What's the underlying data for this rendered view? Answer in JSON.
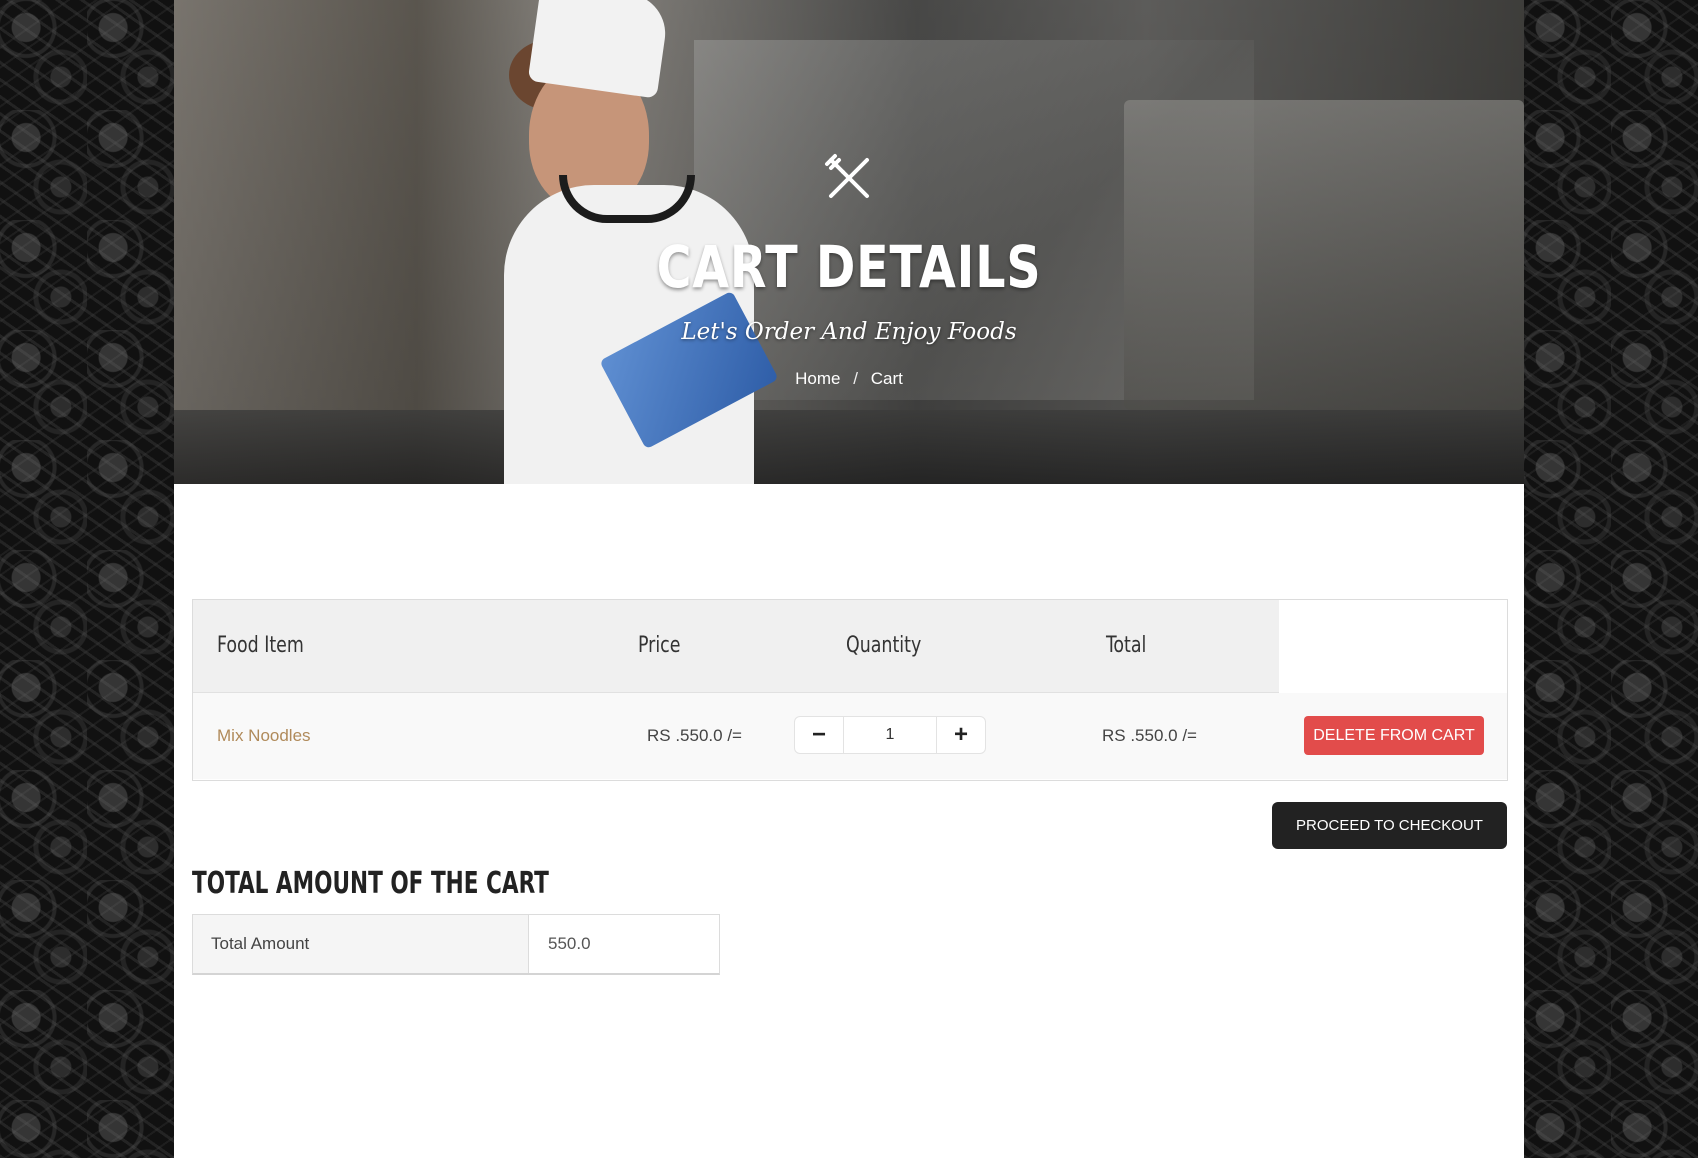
{
  "hero": {
    "icon": "cutlery-icon",
    "title": "CART DETAILS",
    "subtitle": "Let's Order And Enjoy Foods",
    "breadcrumb": {
      "home": "Home",
      "separator": "/",
      "current": "Cart"
    }
  },
  "cart": {
    "columns": [
      "Food Item",
      "Price",
      "Quantity",
      "Total"
    ],
    "rows": [
      {
        "item": "Mix Noodles",
        "price": "RS .550.0 /=",
        "quantity": "1",
        "total": "RS .550.0 /=",
        "delete_label": "DELETE FROM CART",
        "decrement_icon": "minus-icon",
        "increment_icon": "plus-icon"
      }
    ],
    "checkout_label": "PROCEED TO CHECKOUT"
  },
  "summary": {
    "title": "TOTAL AMOUNT OF THE CART",
    "label": "Total Amount",
    "value": "550.0"
  },
  "colors": {
    "accent_item": "#b08a5a",
    "delete_button": "#e24c4b",
    "checkout_button": "#222222"
  }
}
